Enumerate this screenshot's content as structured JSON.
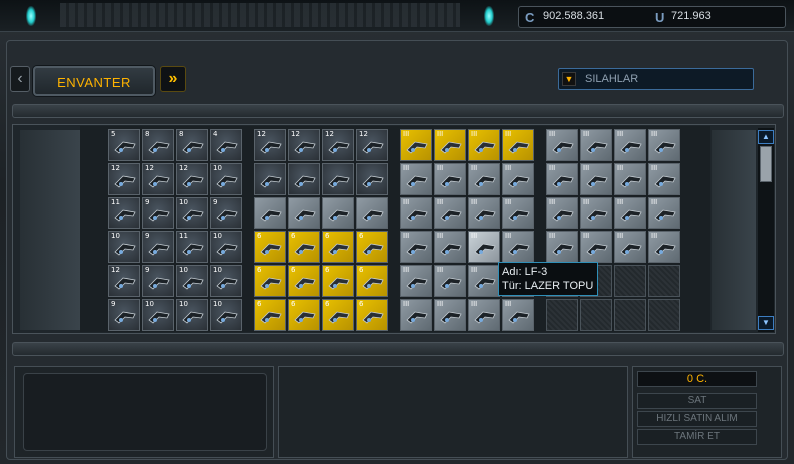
{
  "currency": {
    "credits": "902.588.361",
    "credits_icon": "credits-icon",
    "uridium": "721.963",
    "uridium_icon": "uridium-icon"
  },
  "header": {
    "prev_icon": "chevron-left-icon",
    "tab_label": "ENVANTER",
    "next_icon": "double-chevron-right-icon",
    "category_arrow_icon": "triangle-down-icon",
    "category_label": "SILAHLAR"
  },
  "groups": [
    {
      "rows": [
        [
          {
            "t": "laser",
            "lvl": "5"
          },
          {
            "t": "laser",
            "lvl": "8"
          },
          {
            "t": "laser",
            "lvl": "8"
          },
          {
            "t": "laser",
            "lvl": "4"
          }
        ],
        [
          {
            "t": "laser",
            "lvl": "12"
          },
          {
            "t": "laser",
            "lvl": "12"
          },
          {
            "t": "laser",
            "lvl": "12"
          },
          {
            "t": "laser",
            "lvl": "10"
          }
        ],
        [
          {
            "t": "laser",
            "lvl": "11"
          },
          {
            "t": "laser",
            "lvl": "9"
          },
          {
            "t": "laser",
            "lvl": "10"
          },
          {
            "t": "laser",
            "lvl": "9"
          }
        ],
        [
          {
            "t": "laser",
            "lvl": "10"
          },
          {
            "t": "laser",
            "lvl": "9"
          },
          {
            "t": "laser",
            "lvl": "11"
          },
          {
            "t": "laser",
            "lvl": "10"
          }
        ],
        [
          {
            "t": "laser",
            "lvl": "12"
          },
          {
            "t": "laser",
            "lvl": "9"
          },
          {
            "t": "laser",
            "lvl": "10"
          },
          {
            "t": "laser",
            "lvl": "10"
          }
        ],
        [
          {
            "t": "laser",
            "lvl": "9"
          },
          {
            "t": "laser",
            "lvl": "10"
          },
          {
            "t": "laser",
            "lvl": "10"
          },
          {
            "t": "laser",
            "lvl": "10"
          }
        ]
      ]
    },
    {
      "rows": [
        [
          {
            "t": "laser",
            "lvl": "12"
          },
          {
            "t": "laser",
            "lvl": "12"
          },
          {
            "t": "laser",
            "lvl": "12"
          },
          {
            "t": "laser",
            "lvl": "12"
          }
        ],
        [
          {
            "t": "laser",
            "lvl": ""
          },
          {
            "t": "laser",
            "lvl": ""
          },
          {
            "t": "laser",
            "lvl": ""
          },
          {
            "t": "laser",
            "lvl": ""
          }
        ],
        [
          {
            "t": "grey",
            "lvl": ""
          },
          {
            "t": "grey",
            "lvl": ""
          },
          {
            "t": "grey",
            "lvl": ""
          },
          {
            "t": "grey",
            "lvl": ""
          }
        ],
        [
          {
            "t": "yellow",
            "lvl": "6"
          },
          {
            "t": "yellow",
            "lvl": "6"
          },
          {
            "t": "yellow",
            "lvl": "6"
          },
          {
            "t": "yellow",
            "lvl": "6"
          }
        ],
        [
          {
            "t": "yellow",
            "lvl": "6"
          },
          {
            "t": "yellow",
            "lvl": "6"
          },
          {
            "t": "yellow",
            "lvl": "6"
          },
          {
            "t": "yellow",
            "lvl": "6"
          }
        ],
        [
          {
            "t": "yellow",
            "lvl": "6"
          },
          {
            "t": "yellow",
            "lvl": "6"
          },
          {
            "t": "yellow",
            "lvl": "6"
          },
          {
            "t": "yellow",
            "lvl": "6"
          }
        ]
      ]
    },
    {
      "rows": [
        [
          {
            "t": "yellow",
            "lvl": "III"
          },
          {
            "t": "yellow",
            "lvl": "III"
          },
          {
            "t": "yellow",
            "lvl": "III"
          },
          {
            "t": "yellow",
            "lvl": "III"
          }
        ],
        [
          {
            "t": "grey",
            "lvl": "III"
          },
          {
            "t": "grey",
            "lvl": "III"
          },
          {
            "t": "grey",
            "lvl": "III"
          },
          {
            "t": "grey",
            "lvl": "III"
          }
        ],
        [
          {
            "t": "grey",
            "lvl": "III"
          },
          {
            "t": "grey",
            "lvl": "III"
          },
          {
            "t": "grey",
            "lvl": "III"
          },
          {
            "t": "grey",
            "lvl": "III"
          }
        ],
        [
          {
            "t": "grey",
            "lvl": "III"
          },
          {
            "t": "grey",
            "lvl": "III"
          },
          {
            "t": "light",
            "lvl": "III"
          },
          {
            "t": "grey",
            "lvl": "III"
          }
        ],
        [
          {
            "t": "grey",
            "lvl": "III"
          },
          {
            "t": "grey",
            "lvl": "III"
          },
          {
            "t": "grey",
            "lvl": "III"
          },
          {
            "t": "grey",
            "lvl": "III"
          }
        ],
        [
          {
            "t": "grey",
            "lvl": "III"
          },
          {
            "t": "grey",
            "lvl": "III"
          },
          {
            "t": "grey",
            "lvl": "III"
          },
          {
            "t": "grey",
            "lvl": "III"
          }
        ]
      ]
    },
    {
      "rows": [
        [
          {
            "t": "grey",
            "lvl": "III"
          },
          {
            "t": "grey",
            "lvl": "III"
          },
          {
            "t": "grey",
            "lvl": "III"
          },
          {
            "t": "grey",
            "lvl": "III"
          }
        ],
        [
          {
            "t": "grey",
            "lvl": "III"
          },
          {
            "t": "grey",
            "lvl": "III"
          },
          {
            "t": "grey",
            "lvl": "III"
          },
          {
            "t": "grey",
            "lvl": "III"
          }
        ],
        [
          {
            "t": "grey",
            "lvl": "III"
          },
          {
            "t": "grey",
            "lvl": "III"
          },
          {
            "t": "grey",
            "lvl": "III"
          },
          {
            "t": "grey",
            "lvl": "III"
          }
        ],
        [
          {
            "t": "grey",
            "lvl": "III"
          },
          {
            "t": "grey",
            "lvl": "III"
          },
          {
            "t": "grey",
            "lvl": "III"
          },
          {
            "t": "grey",
            "lvl": "III"
          }
        ],
        [
          {
            "t": "empty",
            "lvl": ""
          },
          {
            "t": "empty",
            "lvl": ""
          },
          {
            "t": "empty",
            "lvl": ""
          },
          {
            "t": "empty",
            "lvl": ""
          }
        ],
        [
          {
            "t": "empty",
            "lvl": ""
          },
          {
            "t": "empty",
            "lvl": ""
          },
          {
            "t": "empty",
            "lvl": ""
          },
          {
            "t": "empty",
            "lvl": ""
          }
        ]
      ]
    }
  ],
  "tooltip": {
    "name": "Adı: LF-3",
    "type": "Tür: LAZER TOPU"
  },
  "scroll": {
    "up_icon": "triangle-up-icon",
    "down_icon": "triangle-down-icon"
  },
  "actions": {
    "price": "0 C.",
    "sell": "SAT",
    "quick_buy": "HIZLI SATIN ALIM",
    "repair": "TAMİR ET"
  },
  "colors": {
    "accent": "#ffb300",
    "tooltip_border": "#2f8fb8"
  }
}
